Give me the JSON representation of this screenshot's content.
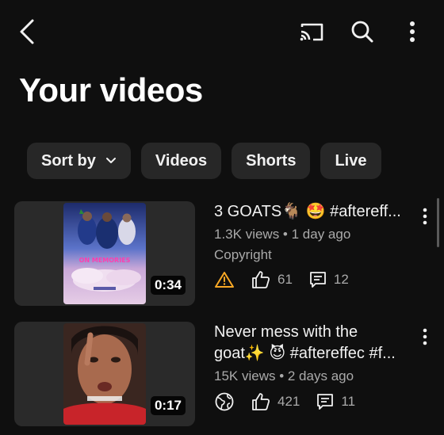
{
  "header": {
    "title": "Your videos",
    "icons": [
      "back-icon",
      "cast-icon",
      "search-icon",
      "more-vertical-icon"
    ]
  },
  "chips": [
    {
      "label": "Sort by",
      "has_dropdown": true
    },
    {
      "label": "Videos"
    },
    {
      "label": "Shorts"
    },
    {
      "label": "Live"
    }
  ],
  "videos": [
    {
      "title": "3 GOATS🐐 🤩 #aftereff...",
      "subtitle": "1.3K views • 1 day ago",
      "note": "Copyright",
      "duration": "0:34",
      "status_icon": "warning-icon",
      "likes": "61",
      "comments": "12",
      "thumb_text": "ON MEMORIES"
    },
    {
      "title_line1": "Never mess with the",
      "title_line2": "goat✨ 😈 #aftereffec #f...",
      "subtitle": "15K views • 2 days ago",
      "duration": "0:17",
      "status_icon": "globe-icon",
      "likes": "421",
      "comments": "11"
    }
  ],
  "colors": {
    "background": "#0f0f0f",
    "chip": "#272727",
    "secondary_text": "#aaaaaa",
    "warning": "#f9a825"
  }
}
